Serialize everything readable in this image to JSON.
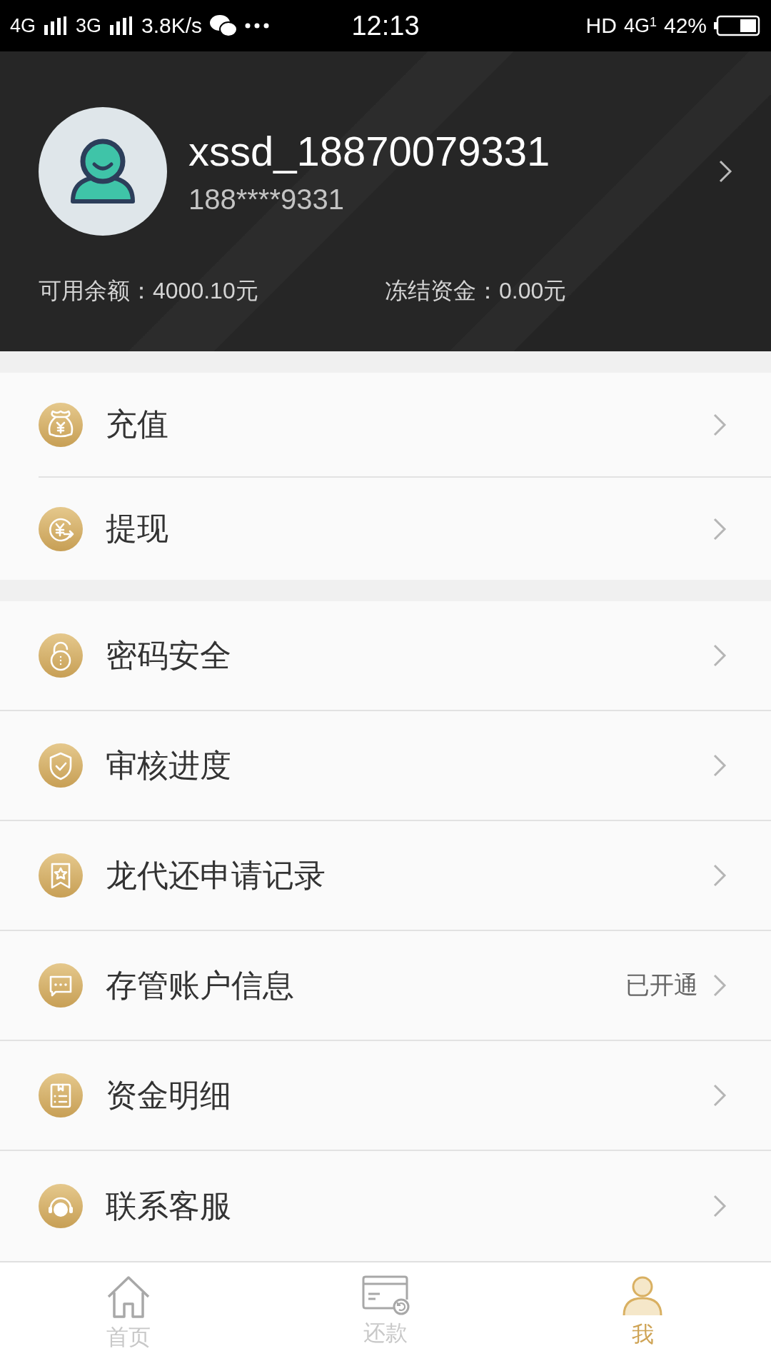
{
  "status_bar": {
    "network_1": "4G",
    "network_2": "3G",
    "speed": "3.8K/s",
    "time": "12:13",
    "hd": "HD",
    "network_3": "4G",
    "sim_slot": "1",
    "battery": "42%"
  },
  "profile": {
    "username": "xssd_18870079331",
    "phone": "188****9331",
    "available_balance": "可用余额：4000.10元",
    "frozen_funds": "冻结资金：0.00元"
  },
  "menu_groups": [
    {
      "items": [
        {
          "label": "充值"
        },
        {
          "label": "提现"
        }
      ]
    },
    {
      "items": [
        {
          "label": "密码安全"
        },
        {
          "label": "审核进度"
        },
        {
          "label": "龙代还申请记录"
        },
        {
          "label": "存管账户信息",
          "value": "已开通"
        },
        {
          "label": "资金明细"
        },
        {
          "label": "联系客服"
        }
      ]
    }
  ],
  "tab_bar": [
    {
      "label": "首页",
      "selected": false
    },
    {
      "label": "还款",
      "selected": false
    },
    {
      "label": "我",
      "selected": true
    }
  ]
}
